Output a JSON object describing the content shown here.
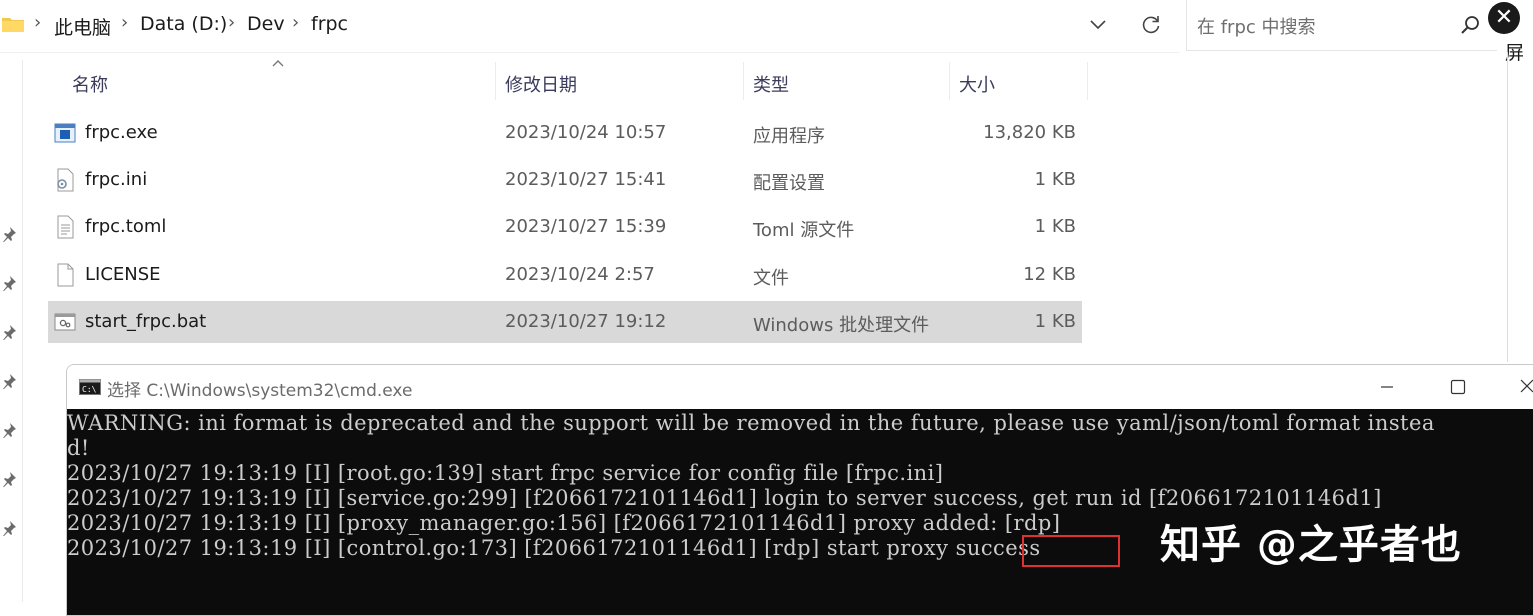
{
  "breadcrumb": [
    "此电脑",
    "Data (D:)",
    "Dev",
    "frpc"
  ],
  "search": {
    "placeholder": "在 frpc 中搜索"
  },
  "side_text": "屏",
  "columns": {
    "name": "名称",
    "modified": "修改日期",
    "type": "类型",
    "size": "大小"
  },
  "files": [
    {
      "name": "frpc.exe",
      "modified": "2023/10/24 10:57",
      "type": "应用程序",
      "size": "13,820 KB",
      "icon": "exe-icon",
      "selected": false
    },
    {
      "name": "frpc.ini",
      "modified": "2023/10/27 15:41",
      "type": "配置设置",
      "size": "1 KB",
      "icon": "ini-file-icon",
      "selected": false
    },
    {
      "name": "frpc.toml",
      "modified": "2023/10/27 15:39",
      "type": "Toml 源文件",
      "size": "1 KB",
      "icon": "text-file-icon",
      "selected": false
    },
    {
      "name": "LICENSE",
      "modified": "2023/10/24 2:57",
      "type": "文件",
      "size": "12 KB",
      "icon": "blank-file-icon",
      "selected": false
    },
    {
      "name": "start_frpc.bat",
      "modified": "2023/10/27 19:12",
      "type": "Windows 批处理文件",
      "size": "1 KB",
      "icon": "batch-file-icon",
      "selected": true
    }
  ],
  "cmd": {
    "title": "选择 C:\\Windows\\system32\\cmd.exe",
    "lines": [
      "WARNING: ini format is deprecated and the support will be removed in the future, please use yaml/json/toml format instea",
      "d!",
      "2023/10/27 19:13:19 [I] [root.go:139] start frpc service for config file [frpc.ini]",
      "2023/10/27 19:13:19 [I] [service.go:299] [f2066172101146d1] login to server success, get run id [f2066172101146d1]",
      "2023/10/27 19:13:19 [I] [proxy_manager.go:156] [f2066172101146d1] proxy added: [rdp]",
      "2023/10/27 19:13:19 [I] [control.go:173] [f2066172101146d1] [rdp] start proxy success"
    ],
    "highlight_word": "success",
    "highlight_color": "#e03030"
  },
  "watermark": "知乎 @之乎者也",
  "colors": {
    "selected_row": "#d9d9d9",
    "console_bg": "#0c0c0c",
    "console_text": "#cccccc"
  }
}
